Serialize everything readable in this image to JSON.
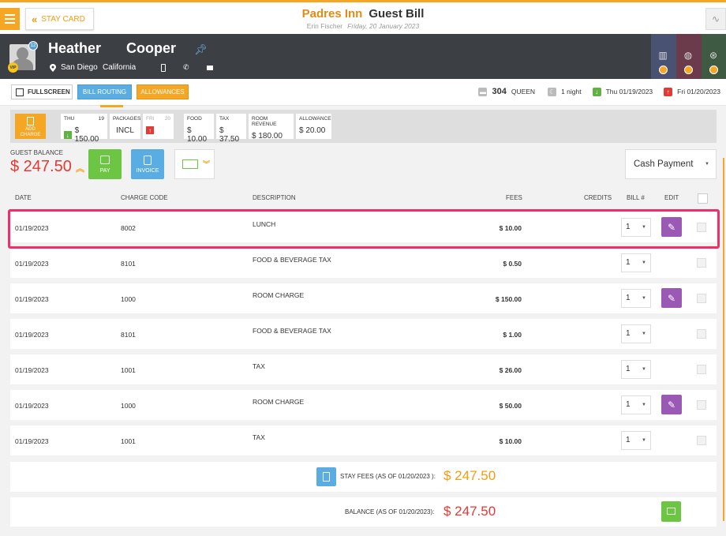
{
  "header": {
    "stay_card_label": "STAY CARD",
    "hotel_name": "Padres Inn",
    "page_title": "Guest Bill",
    "user_name": "Erin Fischer",
    "business_date": "Friday, 20 January 2023"
  },
  "guest": {
    "first_name": "Heather",
    "last_name": "Cooper",
    "city": "San Diego",
    "state": "California",
    "badge_count": "12",
    "vip_label": "VIP"
  },
  "actions": {
    "fullscreen_label": "FULLSCREEN",
    "bill_routing_label": "BILL ROUTING",
    "allowances_label": "ALLOWANCES"
  },
  "stay": {
    "room_number": "304",
    "room_type": "QUEEN",
    "nights": "1 night",
    "arrival": "Thu 01/19/2023",
    "departure": "Fri 01/20/2023"
  },
  "strip": {
    "add_charge_label": "ADD CHARGE",
    "day1_name": "THU",
    "day1_num": "19",
    "day1_amount": "$ 150.00",
    "packages_label": "PACKAGES",
    "packages_value": "INCL",
    "day2_name": "FRI",
    "day2_num": "20",
    "food_label": "FOOD",
    "food_value": "$ 10.00",
    "tax_label": "TAX",
    "tax_value": "$ 37.50",
    "room_revenue_label": "ROOM REVENUE",
    "room_revenue_value": "$ 180.00",
    "allowance_label": "ALLOWANCE",
    "allowance_value": "$ 20.00"
  },
  "balance": {
    "label": "GUEST BALANCE",
    "value": "$ 247.50",
    "pay_label": "PAY",
    "invoice_label": "INVOICE",
    "payment_method": "Cash Payment"
  },
  "table": {
    "headers": {
      "date": "DATE",
      "charge_code": "CHARGE CODE",
      "description": "DESCRIPTION",
      "fees": "FEES",
      "credits": "CREDITS",
      "bill": "BILL #",
      "edit": "EDIT"
    },
    "rows": [
      {
        "date": "01/19/2023",
        "code": "8002",
        "description": "LUNCH",
        "fees": "$ 10.00",
        "bill": "1"
      },
      {
        "date": "01/19/2023",
        "code": "8101",
        "description": "FOOD & BEVERAGE TAX",
        "fees": "$ 0.50",
        "bill": "1"
      },
      {
        "date": "01/19/2023",
        "code": "1000",
        "description": "ROOM CHARGE",
        "fees": "$ 150.00",
        "bill": "1"
      },
      {
        "date": "01/19/2023",
        "code": "8101",
        "description": "FOOD & BEVERAGE TAX",
        "fees": "$ 1.00",
        "bill": "1"
      },
      {
        "date": "01/19/2023",
        "code": "1001",
        "description": "TAX",
        "fees": "$ 26.00",
        "bill": "1"
      },
      {
        "date": "01/19/2023",
        "code": "1000",
        "description": "ROOM CHARGE",
        "fees": "$ 50.00",
        "bill": "1"
      },
      {
        "date": "01/19/2023",
        "code": "1001",
        "description": "TAX",
        "fees": "$ 10.00",
        "bill": "1"
      }
    ]
  },
  "totals": {
    "stay_fees_label": "STAY FEES (AS OF  01/20/2023 ):",
    "stay_fees_value": "$ 247.50",
    "balance_label": "BALANCE (AS OF  01/20/2023):",
    "balance_value": "$ 247.50"
  },
  "colors": {
    "accent": "#f5a623",
    "danger": "#e53935",
    "highlight": "#ee2f6a"
  }
}
